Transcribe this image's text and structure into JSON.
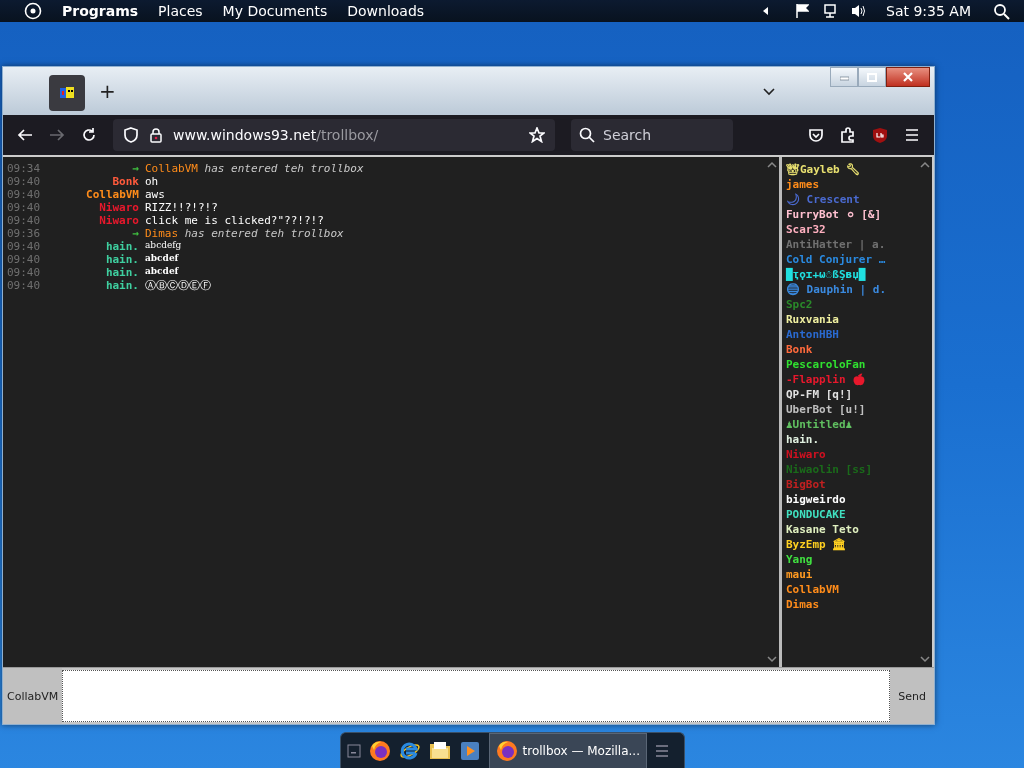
{
  "top_bar": {
    "menu": [
      "Programs",
      "Places",
      "My Documents",
      "Downloads"
    ],
    "clock": "Sat 9:35 AM"
  },
  "browser": {
    "tabs": [
      {
        "selected": true
      }
    ],
    "new_tab": "+",
    "url_host": "www.windows93.net",
    "url_path": "/trollbox/",
    "search": {
      "placeholder": "Search"
    }
  },
  "chat": {
    "messages": [
      {
        "kind": "join",
        "time": "09:34",
        "arrow": "→",
        "nick": "CollabVM",
        "color": "#ff8c1a",
        "text": "has entered teh trollbox"
      },
      {
        "kind": "plain",
        "time": "09:40",
        "nick": "Bonk",
        "color": "#ff5a3c",
        "text": "oh"
      },
      {
        "kind": "plain",
        "time": "09:40",
        "nick": "CollabVM",
        "color": "#ff8c1a",
        "text": "aws"
      },
      {
        "kind": "plain",
        "time": "09:40",
        "nick": "Niwaro",
        "color": "#e8182c",
        "text": "RIZZ!!?!?!?"
      },
      {
        "kind": "plain",
        "time": "09:40",
        "nick": "Niwaro",
        "color": "#e8182c",
        "text": "click me is clicked?\"??!?!?"
      },
      {
        "kind": "join",
        "time": "09:36",
        "arrow": "→",
        "nick": "Dimas",
        "color": "#ff8c1a",
        "text": "has entered teh trollbox"
      },
      {
        "kind": "serif",
        "time": "09:40",
        "nick": "hain.",
        "color": "#3fd0a0",
        "text": "abcdefg"
      },
      {
        "kind": "bold",
        "time": "09:40",
        "nick": "hain.",
        "color": "#3fd0a0",
        "text": "abcdef"
      },
      {
        "kind": "bold",
        "time": "09:40",
        "nick": "hain.",
        "color": "#3fd0a0",
        "text": "abcdef"
      },
      {
        "kind": "plain",
        "time": "09:40",
        "nick": "hain.",
        "color": "#3fd0a0",
        "text": "ⒶⒷⒸⒹⒺⒻ"
      }
    ]
  },
  "users": [
    {
      "name": "👑Gayleb 🔧",
      "color": "#e8e070"
    },
    {
      "name": "james",
      "color": "#ff8c1a"
    },
    {
      "name": "🌙 Crescent",
      "color": "#4a6ad0"
    },
    {
      "name": "FurryBot ⚪ [&]",
      "color": "#ffc0d0"
    },
    {
      "name": "Scar32",
      "color": "#ffb0c0"
    },
    {
      "name": "AntiHatter | a.",
      "color": "#707070"
    },
    {
      "name": "Cold Conjurer …",
      "color": "#2a8ae0"
    },
    {
      "name": "█ҭϙɪ+ω☃ßŞʙџ█",
      "color": "#20e0e0"
    },
    {
      "name": "🔵 Dauphin | d.",
      "color": "#3a8ae0"
    },
    {
      "name": "Spc2",
      "color": "#2a8a2a"
    },
    {
      "name": "Ruxvania",
      "color": "#f0f0a0"
    },
    {
      "name": "AntonHBH",
      "color": "#2a6ad0"
    },
    {
      "name": "Bonk",
      "color": "#ff6a3c"
    },
    {
      "name": "PescaroloFan",
      "color": "#30e030"
    },
    {
      "name": "-Flapplin 🍎",
      "color": "#e8182c"
    },
    {
      "name": "QP-FM [q!]",
      "color": "#e0e0e0"
    },
    {
      "name": "UberBot [u!]",
      "color": "#c0c0c0"
    },
    {
      "name": "♟Untitled♟",
      "color": "#60c060"
    },
    {
      "name": "hain.",
      "color": "#e0f0e0"
    },
    {
      "name": "Niwaro",
      "color": "#d01020"
    },
    {
      "name": "Niwaolin [ss]",
      "color": "#1a6a1a"
    },
    {
      "name": "BigBot",
      "color": "#c02020"
    },
    {
      "name": "bigweirdo",
      "color": "#ffffff"
    },
    {
      "name": "PONDUCAKE",
      "color": "#40e0c0"
    },
    {
      "name": "Kasane Teto",
      "color": "#e0f0c0"
    },
    {
      "name": "ByzEmp 🏛",
      "color": "#ffd020"
    },
    {
      "name": "Yang",
      "color": "#40e040"
    },
    {
      "name": "maui",
      "color": "#ff9a20"
    },
    {
      "name": "CollabVM",
      "color": "#ff8c1a"
    },
    {
      "name": "Dimas",
      "color": "#ff8c1a"
    }
  ],
  "input": {
    "nick_button": "CollabVM",
    "send_button": "Send"
  },
  "taskbar": {
    "task": "trollbox — Mozilla..."
  }
}
